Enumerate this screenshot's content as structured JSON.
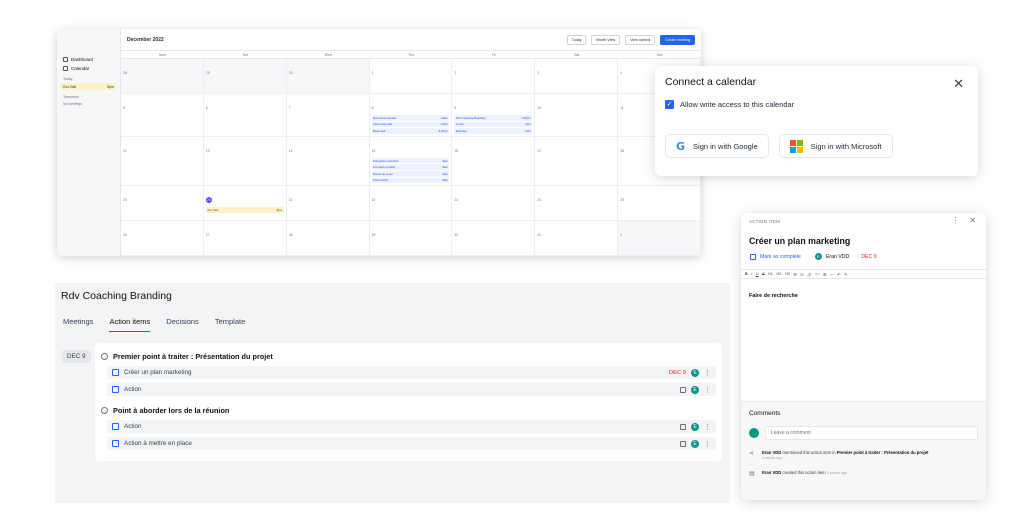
{
  "calendar": {
    "month": "December 2022",
    "buttons": {
      "today": "Today",
      "month_view": "Month View",
      "view_options": "View options",
      "create": "Create meeting"
    },
    "sidebar": {
      "dashboard": "Dashboard",
      "calendar": "Calendar",
      "today": "Today",
      "today_event": {
        "name": "Zoo Visit",
        "time": "8pm"
      },
      "tomorrow": "Tomorrow",
      "no_meetings": "No meetings"
    },
    "weekdays": [
      "Mon",
      "Tue",
      "Wed",
      "Thu",
      "Fri",
      "Sat",
      "Sun"
    ],
    "days": [
      "28",
      "29",
      "30",
      "1",
      "2",
      "3",
      "4",
      "5",
      "6",
      "7",
      "8",
      "9",
      "10",
      "11",
      "12",
      "13",
      "14",
      "15",
      "16",
      "17",
      "18",
      "19",
      "20",
      "21",
      "22",
      "23",
      "24",
      "25",
      "26",
      "27",
      "28",
      "29",
      "30",
      "31",
      "1"
    ],
    "events": {
      "thu_w2": [
        {
          "name": "Remorque reunion",
          "time": "11am"
        },
        {
          "name": "Sport team talk",
          "time": "12pm"
        },
        {
          "name": "Book club",
          "time": "3:30pm"
        }
      ],
      "fri_w2": [
        {
          "name": "Rdv Coaching Branding",
          "time": "2:30pm"
        },
        {
          "name": "Lunch",
          "time": "4pm"
        },
        {
          "name": "Entretien",
          "time": "5pm"
        }
      ],
      "thu_w3": [
        {
          "name": "Entreprise rencontre",
          "time": "9am"
        },
        {
          "name": "Formation produit",
          "time": "9am"
        },
        {
          "name": "Revue de projet",
          "time": "9am"
        },
        {
          "name": "Point hebdo",
          "time": "9am"
        }
      ],
      "tue_w4": [
        {
          "name": "Zoo Visit",
          "time": "8pm"
        }
      ]
    }
  },
  "connect": {
    "title": "Connect a calendar",
    "checkbox_label": "Allow write access to this calendar",
    "google": "Sign in with Google",
    "microsoft": "Sign in with Microsoft",
    "google_glyph": "G"
  },
  "meeting": {
    "title": "Rdv Coaching Branding",
    "tabs": [
      "Meetings",
      "Action items",
      "Decisions",
      "Template"
    ],
    "date": "DEC 9",
    "groups": [
      {
        "title": "Premier point à traiter : Présentation du projet",
        "items": [
          {
            "label": "Créer un plan marketing",
            "due": "DEC 9",
            "avatar": "E"
          },
          {
            "label": "Action",
            "avatar": "E"
          }
        ]
      },
      {
        "title": "Point à aborder lors de la réunion",
        "items": [
          {
            "label": "Action",
            "avatar": "E"
          },
          {
            "label": "Action à mettre en place",
            "avatar": "E"
          }
        ]
      }
    ]
  },
  "action_item": {
    "label": "ACTION ITEM",
    "title": "Créer un plan marketing",
    "mark_complete": "Mark as complete",
    "owner": "Eran VDD",
    "owner_initial": "E",
    "due": "DEC 9",
    "toolbar": [
      "B",
      "I",
      "U",
      "S",
      "H1",
      "H2",
      "H3",
      "☰",
      "☷",
      "🔗",
      "<>",
      "⊞",
      "—",
      "↶",
      "↷"
    ],
    "body": "Faire de recherche",
    "comments_title": "Comments",
    "comment_placeholder": "Leave a comment",
    "activity": [
      {
        "actor": "Eran VDD",
        "text": "mentioned this action item in",
        "target": "Premier point à traiter : Présentation du projet",
        "time": "2 weeks ago"
      },
      {
        "actor": "Eran VDD",
        "text": "created this action item",
        "time": "2 weeks ago"
      }
    ]
  },
  "colors": {
    "accent": "#2563eb",
    "due": "#dc2626",
    "avatar": "#0d9488",
    "highlight": "#fdf1c7"
  }
}
